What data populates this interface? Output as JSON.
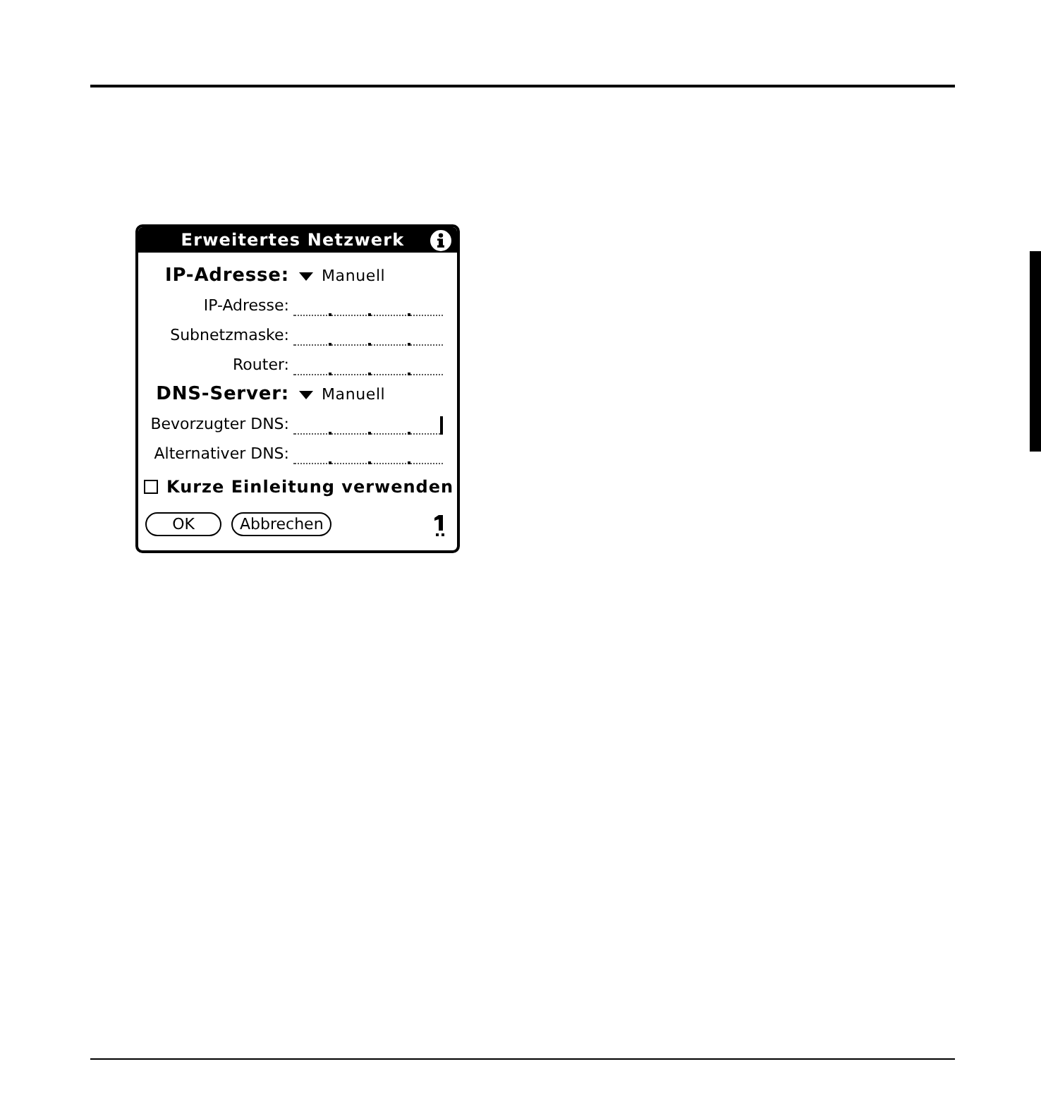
{
  "dialog": {
    "title": "Erweitertes Netzwerk",
    "rows": [
      {
        "kind": "picker",
        "label": "IP-Adresse:",
        "value": "Manuell"
      },
      {
        "kind": "ip_field",
        "label": "IP-Adresse:",
        "focused": false
      },
      {
        "kind": "ip_field",
        "label": "Subnetzmaske:",
        "focused": false
      },
      {
        "kind": "ip_field",
        "label": "Router:",
        "focused": false
      },
      {
        "kind": "picker",
        "label": "DNS-Server:",
        "value": "Manuell"
      },
      {
        "kind": "ip_field",
        "label": "Bevorzugter DNS:",
        "focused": true
      },
      {
        "kind": "ip_field",
        "label": "Alternativer DNS:",
        "focused": false
      }
    ],
    "checkbox": {
      "label": "Kurze Einleitung verwenden",
      "checked": false
    },
    "buttons": [
      "OK",
      "Abbrechen"
    ]
  }
}
